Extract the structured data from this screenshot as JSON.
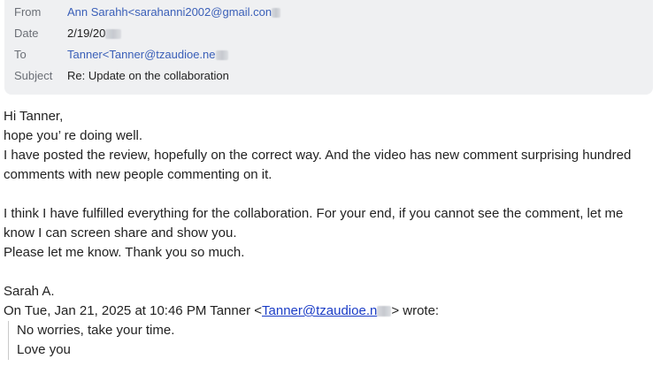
{
  "header": {
    "from_label": "From",
    "from_value": "Ann Sarahh<sarahanni2002@gmail.con",
    "date_label": "Date",
    "date_value": "2/19/20",
    "to_label": "To",
    "to_value": "Tanner<Tanner@tzaudioe.ne",
    "subject_label": "Subject",
    "subject_value": "Re: Update on the collaboration"
  },
  "body": {
    "greeting": "Hi Tanner,",
    "line1": "hope you’ re doing well.",
    "para1": "I have posted the review, hopefully on the correct way. And the video has new comment surprising hundred comments with new people commenting on it.",
    "para2": "I think I have fulfilled everything for the collaboration. For your end, if you cannot see the comment, let me know I can screen share and show you.",
    "line2": "Please let me know. Thank you so much.",
    "signature": "Sarah A.",
    "reply_intro": "On Tue, Jan 21, 2025 at 10:46 PM Tanner <",
    "reply_email": "Tanner@tzaudioe.n",
    "reply_outro": "> wrote:",
    "quote_line1": "No worries, take your time.",
    "quote_line2": "Love you"
  }
}
